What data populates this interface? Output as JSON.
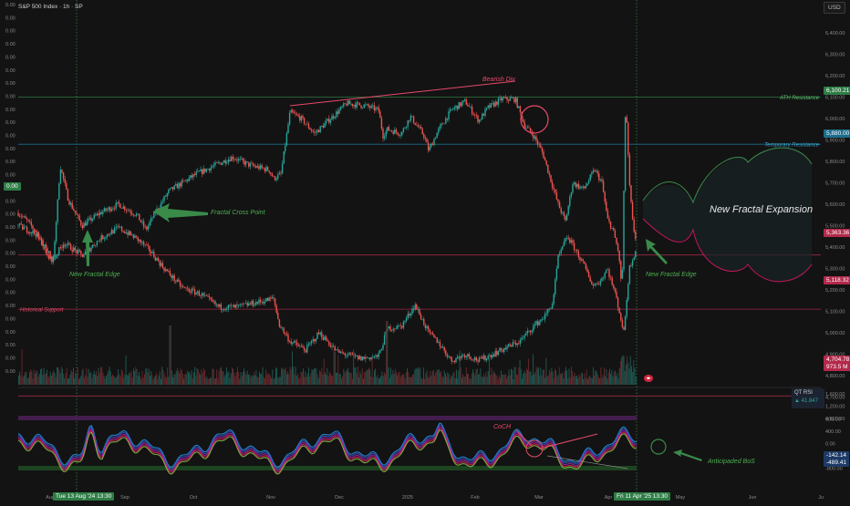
{
  "header": {
    "symbol": "S&P 500 Index · 1h · SP",
    "currency": "USD"
  },
  "chart_data": {
    "type": "line",
    "price_axis": {
      "ticks": [
        "6,400.00",
        "6,300.00",
        "6,200.00",
        "6,100.00",
        "6,000.00",
        "5,900.00",
        "5,800.00",
        "5,700.00",
        "5,600.00",
        "5,500.00",
        "5,400.00",
        "5,300.00",
        "5,200.00",
        "5,100.00",
        "5,000.00",
        "4,900.00",
        "4,800.00",
        "4,700.00",
        "4,600.00"
      ]
    },
    "left_axis_labels": [
      "0.00",
      "0.00",
      "0.00",
      "0.00",
      "0.00",
      "0.00",
      "0.00",
      "0.00",
      "0.00",
      "0.00",
      "0.00",
      "0.00",
      "0.00",
      "0.00",
      "0.00",
      "0.00",
      "0.00",
      "0.00",
      "0.00",
      "0.00",
      "0.00",
      "0.00",
      "0.00",
      "0.00",
      "0.00",
      "0.00",
      "0.00",
      "0.00",
      "0.00"
    ],
    "time_axis": [
      "Aug",
      "Sep",
      "Oct",
      "Nov",
      "Dec",
      "2025",
      "Feb",
      "Mar",
      "Apr",
      "May",
      "Jun",
      "Ju"
    ],
    "time_badges": {
      "left": "Tue 13 Aug '24  13:30",
      "right": "Fri 11 Apr '25  13:30"
    },
    "levels": [
      {
        "name": "ATH Resistance",
        "value": 6100,
        "badge": "6,100.21",
        "color": "#2e7d46"
      },
      {
        "name": "Temporary Resistance",
        "value": 5880,
        "badge": "5,880.00",
        "color": "#1b6d8c"
      },
      {
        "name": "",
        "value": 5363,
        "badge": "5,363.36",
        "color": "#9c2a44"
      },
      {
        "name": "Historical Support",
        "value": 5110,
        "badge": "5,118.32",
        "color": "#9c2a44"
      },
      {
        "name": "Support",
        "value": 4705,
        "badge": "4,704.78",
        "color": "#9c2a44"
      }
    ],
    "extra_badges": [
      "973.5 M"
    ],
    "left_badge": "0.00",
    "annotations": {
      "bearish_div": "Bearish Div",
      "fractal_cross": "Fractal Cross Point",
      "fractal_edge_left": "New Fractal Edge",
      "fractal_edge_right": "New Fractal Edge",
      "expansion": "New Fractal Expansion",
      "coch": "CoCH",
      "bos": "Anticipaded BoS"
    },
    "colors": {
      "up": "#26a69a",
      "down": "#ef5350",
      "green": "#4caf50",
      "red": "#e91e63",
      "blue": "#2196f3"
    }
  },
  "oscillator": {
    "name": "QT RSI",
    "value": "41.847",
    "axis": [
      "1,600.00",
      "1,200.00",
      "800.00",
      "400.00",
      "0.00",
      "-400.00",
      "-800.00"
    ],
    "badges": [
      "-142.14",
      "-489.41"
    ]
  }
}
